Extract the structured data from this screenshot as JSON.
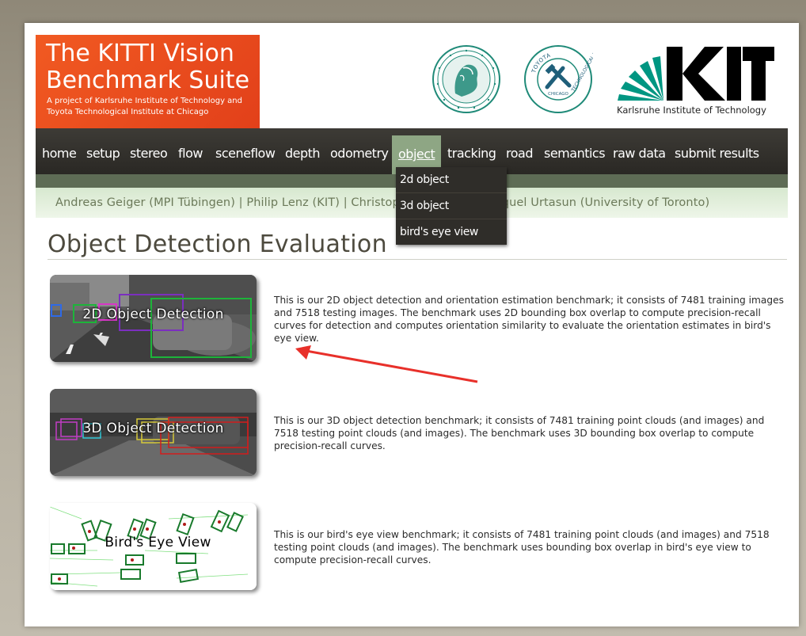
{
  "header": {
    "logo_title": "The KITTI Vision Benchmark Suite",
    "logo_subtitle": "A project of Karlsruhe Institute of Technology and Toyota Technological Institute at Chicago",
    "tti_top_text": "TOYOTA",
    "tti_side_text": "TECHNOLOGICAL INSTITUTE",
    "tti_center_text": "CHICAGO",
    "kit_caption": "Karlsruhe Institute of Technology",
    "brand_orange": "#f15a22",
    "kit_green": "#009682"
  },
  "nav": {
    "items": [
      {
        "label": "home"
      },
      {
        "label": "setup"
      },
      {
        "label": "stereo"
      },
      {
        "label": "flow"
      },
      {
        "label": "sceneflow"
      },
      {
        "label": "depth"
      },
      {
        "label": "odometry"
      },
      {
        "label": "object",
        "active": true
      },
      {
        "label": "tracking"
      },
      {
        "label": "road"
      },
      {
        "label": "semantics"
      },
      {
        "label": "raw data"
      },
      {
        "label": "submit results"
      }
    ],
    "active_color": "#8ea684"
  },
  "dropdown": {
    "items": [
      {
        "label": "2d object"
      },
      {
        "label": "3d object"
      },
      {
        "label": "bird's eye view"
      }
    ]
  },
  "authors": "Andreas Geiger (MPI Tübingen) | Philip Lenz (KIT) | Christoph Stiller (KIT) | Raquel Urtasun (University of Toronto)",
  "page_title": "Object Detection Evaluation",
  "benchmarks": [
    {
      "label": "2D Object Detection",
      "description": "This is our 2D object detection and orientation estimation benchmark; it consists of 7481 training images and 7518 testing images. The benchmark uses 2D bounding box overlap to compute precision-recall curves for detection and computes orientation similarity to evaluate the orientation estimates in bird's eye view."
    },
    {
      "label": "3D Object Detection",
      "description": "This is our 3D object detection benchmark; it consists of 7481 training point clouds (and images) and 7518 testing point clouds (and images). The benchmark uses 3D bounding box overlap to compute precision-recall curves."
    },
    {
      "label": "Bird's Eye View",
      "description": "This is our bird's eye view benchmark; it consists of 7481 training point clouds (and images) and 7518 testing point clouds (and images). The benchmark uses bounding box overlap in bird's eye view to compute precision-recall curves."
    }
  ],
  "annotation_arrow_color": "#e8302a"
}
